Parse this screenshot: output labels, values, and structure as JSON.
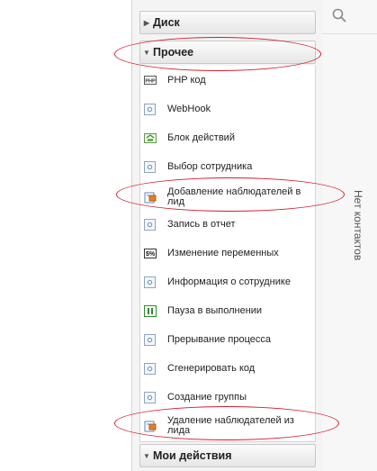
{
  "panel": {
    "sections": {
      "disk": "Диск",
      "other": "Прочее",
      "my_actions": "Мои действия"
    },
    "items": [
      {
        "label": "PHP код",
        "icon": "php-icon"
      },
      {
        "label": "WebHook",
        "icon": "generic-activity-icon"
      },
      {
        "label": "Блок действий",
        "icon": "block-icon"
      },
      {
        "label": "Выбор сотрудника",
        "icon": "generic-activity-icon"
      },
      {
        "label": "Добавление наблюдателей в лид",
        "icon": "watchers-icon"
      },
      {
        "label": "Запись в отчет",
        "icon": "generic-activity-icon"
      },
      {
        "label": "Изменение переменных",
        "icon": "variables-icon"
      },
      {
        "label": "Информация о сотруднике",
        "icon": "generic-activity-icon"
      },
      {
        "label": "Пауза в выполнении",
        "icon": "pause-icon"
      },
      {
        "label": "Прерывание процесса",
        "icon": "generic-activity-icon"
      },
      {
        "label": "Сгенерировать код",
        "icon": "generic-activity-icon"
      },
      {
        "label": "Создание группы",
        "icon": "generic-activity-icon"
      },
      {
        "label": "Удаление наблюдателей из лида",
        "icon": "watchers-icon"
      }
    ]
  },
  "right": {
    "no_contacts": "Нет контактов",
    "search_icon": "search-icon"
  },
  "colors": {
    "annotation": "#d21e2c"
  }
}
